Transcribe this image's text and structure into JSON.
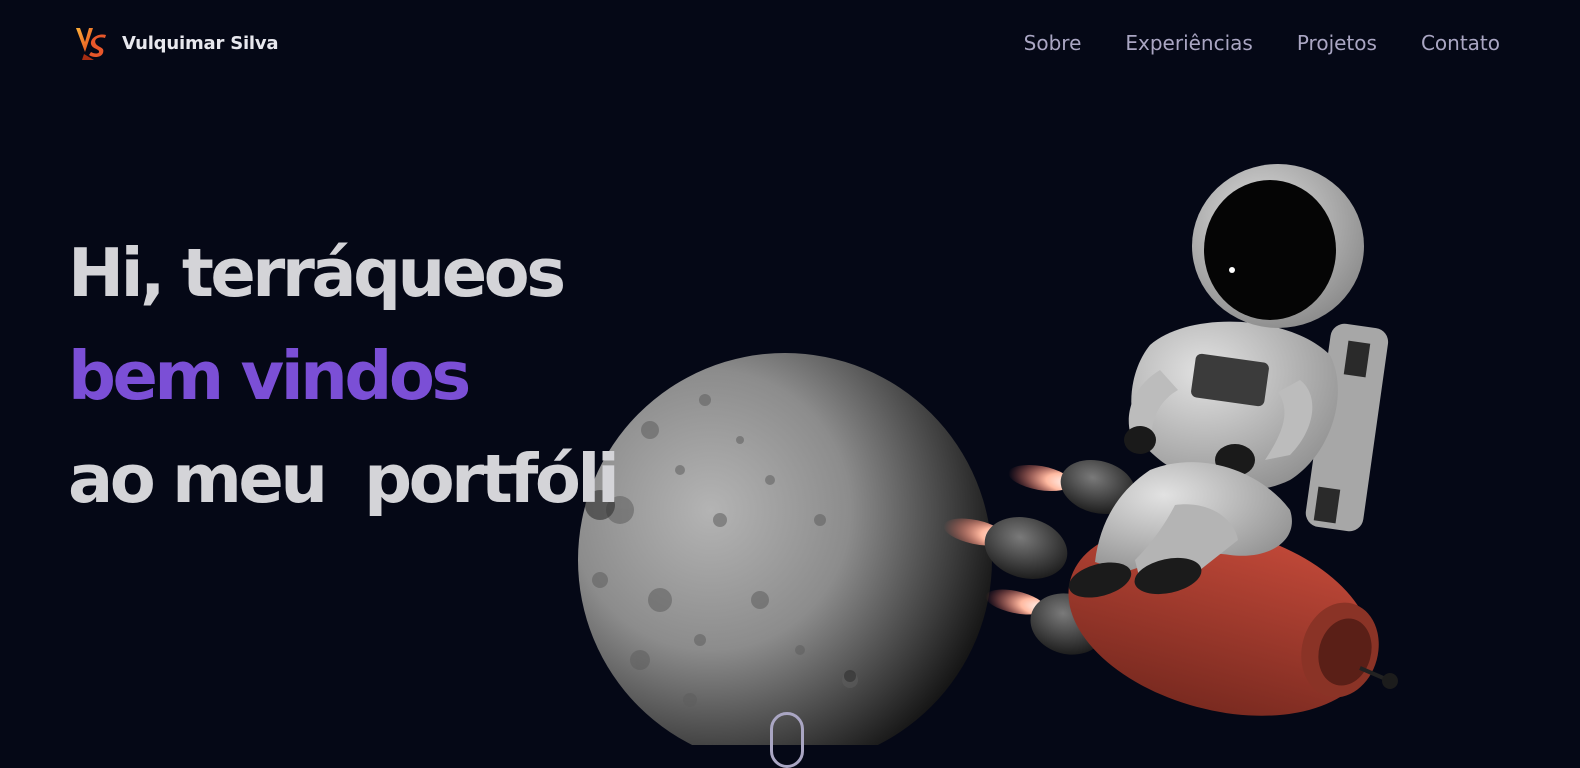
{
  "navbar": {
    "brand_name": "Vulquimar Silva",
    "logo_icon": "vs-logo-icon",
    "links": [
      {
        "label": "Sobre"
      },
      {
        "label": "Experiências"
      },
      {
        "label": "Projetos"
      },
      {
        "label": "Contato"
      }
    ]
  },
  "hero": {
    "line1": "Hi, terráqueos",
    "line2": "bem vindos",
    "line3": "ao meu  portfóli"
  },
  "scene": {
    "moon": "moon-image",
    "astronaut": "astronaut-on-rocket-image"
  },
  "scroll_icon": "scroll-down-icon",
  "colors": {
    "background": "#050816",
    "accent": "#7b4fd6",
    "heading": "#d4d4d8",
    "nav_text": "#aaa6c3"
  }
}
